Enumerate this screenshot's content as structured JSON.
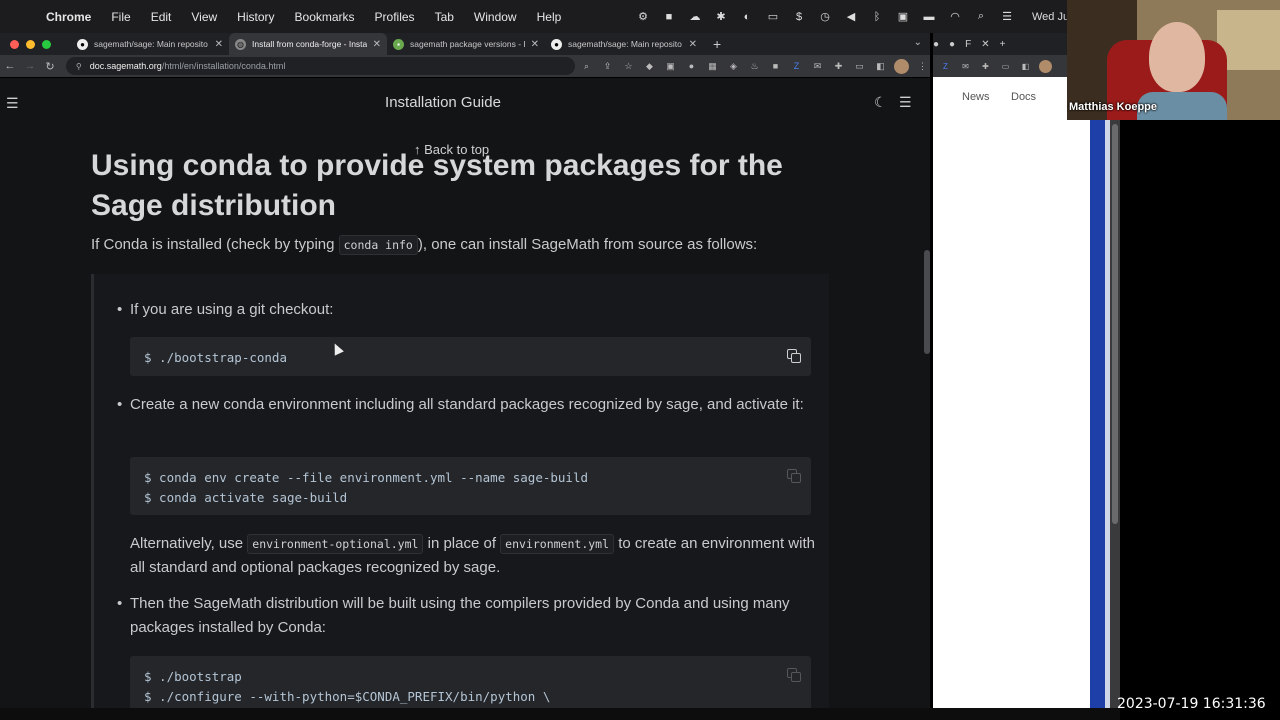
{
  "menubar": {
    "app_name": "Chrome",
    "items": [
      "File",
      "Edit",
      "View",
      "History",
      "Bookmarks",
      "Profiles",
      "Tab",
      "Window",
      "Help"
    ],
    "clock": "Wed Jul"
  },
  "tabs": [
    {
      "title": "sagemath/sage: Main reposito",
      "icon": "github-icon"
    },
    {
      "title": "Install from conda-forge - Insta",
      "icon": "globe-icon",
      "active": true
    },
    {
      "title": "sagemath package versions - I",
      "icon": "repology-icon"
    },
    {
      "title": "sagemath/sage: Main reposito",
      "icon": "github-icon"
    }
  ],
  "omnibox": {
    "domain": "doc.sagemath.org",
    "path": "/html/en/installation/conda.html"
  },
  "page": {
    "header_title": "Installation Guide",
    "back_to_top": "Back to top",
    "heading": "Using conda to provide system packages for the Sage distribution",
    "intro_before": "If Conda is installed (check by typing ",
    "intro_code": "conda info",
    "intro_after": "), one can install SageMath from source as follows:",
    "item1": "If you are using a git checkout:",
    "code1_line1": "$ ./bootstrap-conda",
    "item2": "Create a new conda environment including all standard packages recognized by sage, and activate it:",
    "code2_line1": "$ conda env create --file environment.yml --name sage-build",
    "code2_line2": "$ conda activate sage-build",
    "alt_before": "Alternatively, use ",
    "alt_code1": "environment-optional.yml",
    "alt_mid": " in place of ",
    "alt_code2": "environment.yml",
    "alt_after": " to create an environment with all standard and optional packages recognized by sage.",
    "item3": "Then the SageMath distribution will be built using the compilers provided by Conda and using many packages installed by Conda:",
    "code3_line1": "$ ./bootstrap",
    "code3_line2": "$ ./configure --with-python=$CONDA_PREFIX/bin/python \\"
  },
  "second_window": {
    "nav_news": "News",
    "nav_docs": "Docs"
  },
  "webcam": {
    "name": "Matthias Koeppe"
  },
  "timestamp": "2023-07-19 16:31:36"
}
